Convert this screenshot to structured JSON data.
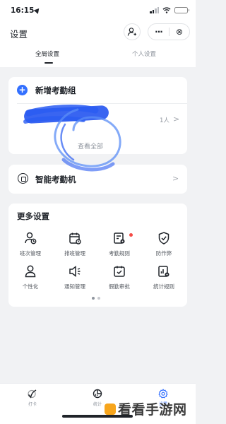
{
  "status_bar": {
    "time": "16:15"
  },
  "header": {
    "title": "设置",
    "more_label": "···",
    "close_label": "⊗",
    "tabs": [
      {
        "label": "全局设置"
      },
      {
        "label": "个人设置"
      }
    ]
  },
  "attendance_group": {
    "new_group_label": "新增考勤组",
    "member_count": "1人",
    "view_all_label": "查看全部"
  },
  "smart_attendance": {
    "label": "智能考勤机"
  },
  "more_settings": {
    "title": "更多设置",
    "items": [
      {
        "label": "班次管理",
        "icon": "shift-management-icon"
      },
      {
        "label": "排班管理",
        "icon": "scheduling-icon"
      },
      {
        "label": "考勤规则",
        "icon": "attendance-rules-icon",
        "badge": true
      },
      {
        "label": "防作弊",
        "icon": "anti-cheat-shield-icon"
      },
      {
        "label": "个性化",
        "icon": "personalization-icon"
      },
      {
        "label": "通知管理",
        "icon": "notification-icon"
      },
      {
        "label": "假勤审批",
        "icon": "leave-approval-icon"
      },
      {
        "label": "统计规则",
        "icon": "statistics-rules-icon"
      }
    ],
    "page_count": 2,
    "current_page": 1
  },
  "bottom_nav": [
    {
      "label": "打卡",
      "icon": "check-in-icon"
    },
    {
      "label": "统计",
      "icon": "statistics-icon"
    },
    {
      "label": "设置",
      "icon": "settings-gear-icon",
      "active": true
    }
  ],
  "watermark": {
    "text": "看看手游网"
  },
  "colors": {
    "accent": "#3370ff",
    "badge": "#f54a45",
    "scribble": "#2a5cf2"
  }
}
